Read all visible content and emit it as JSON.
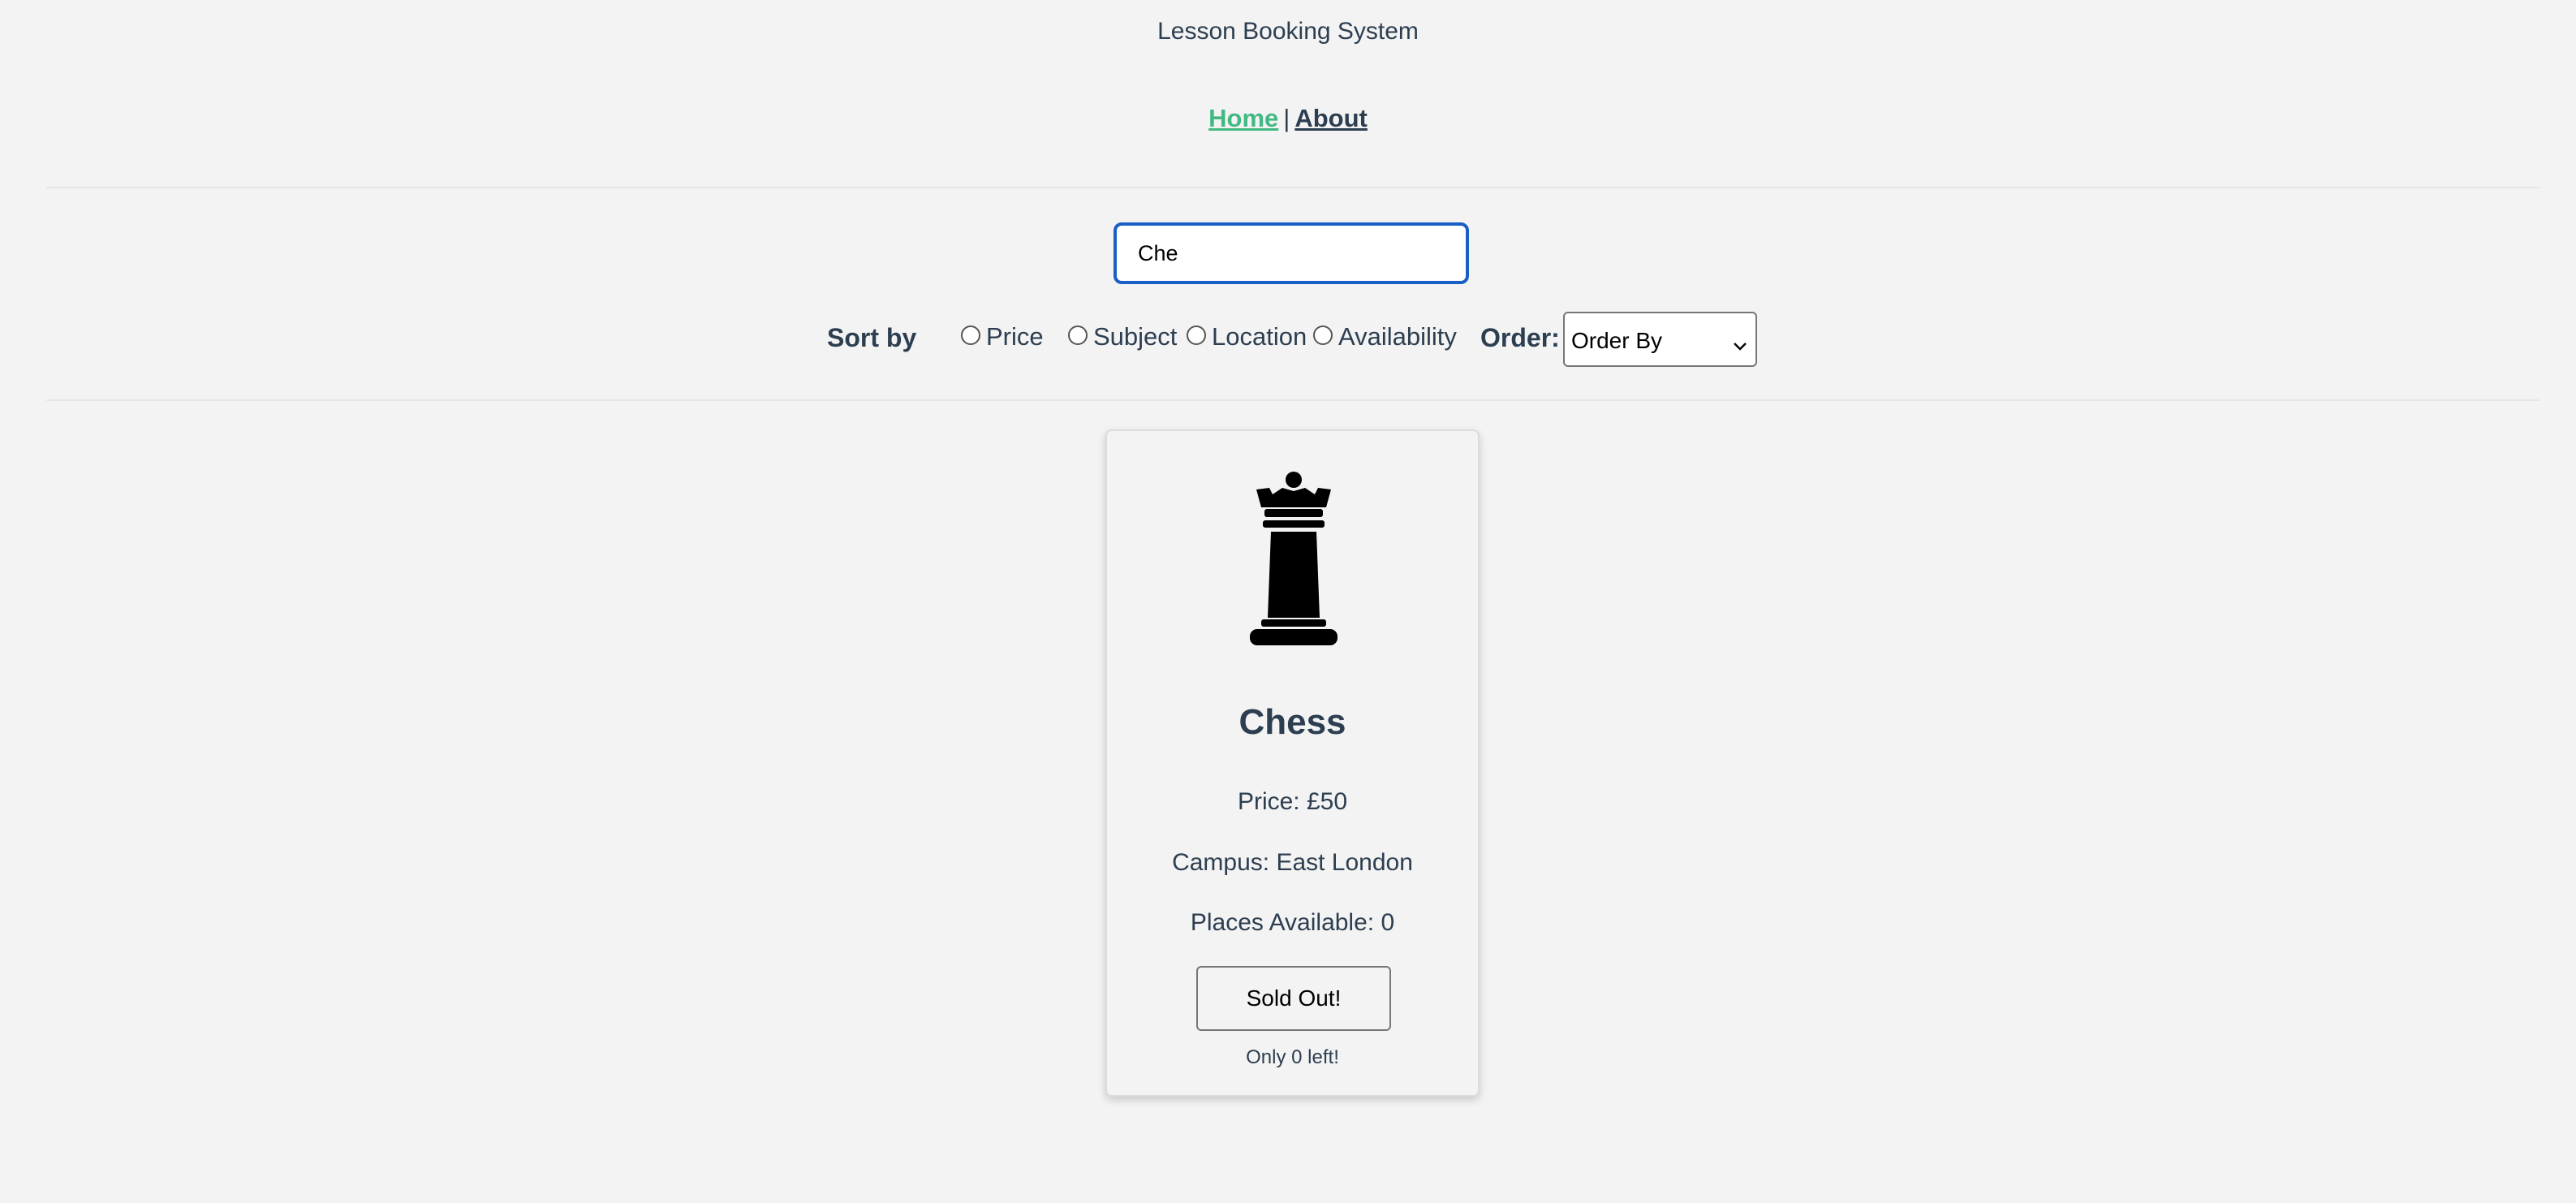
{
  "header": {
    "title": "Lesson Booking System",
    "nav": {
      "home": "Home",
      "separator": "|",
      "about": "About"
    },
    "active_color": "#42b983"
  },
  "search": {
    "value": "Che",
    "placeholder": ""
  },
  "sort": {
    "label": "Sort by",
    "options": [
      "Price",
      "Subject",
      "Location",
      "Availability"
    ],
    "order_label": "Order:",
    "order_value": "Order By"
  },
  "lessons": [
    {
      "icon": "chess-rook-icon",
      "subject": "Chess",
      "price": "Price: £50",
      "campus": "Campus: East London",
      "places": "Places Available: 0",
      "button": "Sold Out!",
      "note": "Only 0 left!"
    }
  ]
}
